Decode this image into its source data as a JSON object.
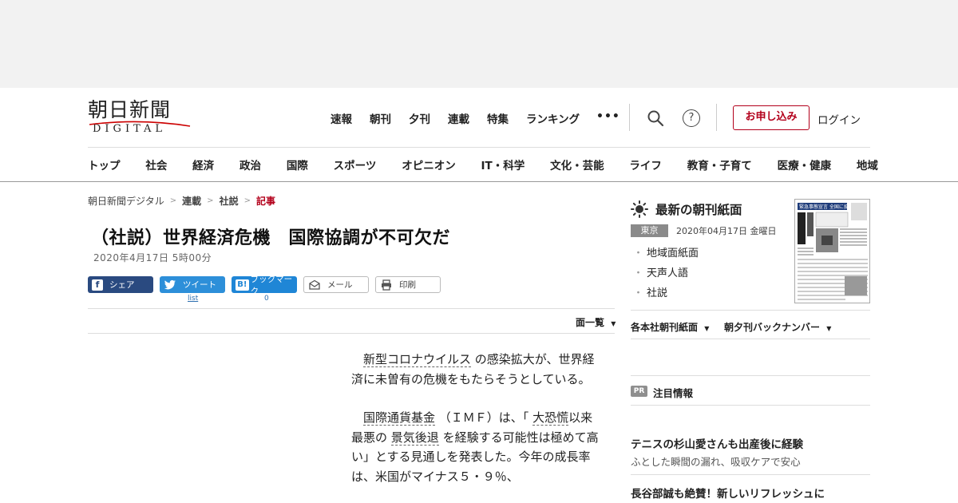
{
  "header": {
    "logo_main": "朝日新聞",
    "logo_sub": "DIGITAL",
    "top_nav": [
      "速報",
      "朝刊",
      "夕刊",
      "連載",
      "特集",
      "ランキング"
    ],
    "more": "•••",
    "help": "?",
    "subscribe": "お申し込み",
    "login": "ログイン"
  },
  "categories": [
    "トップ",
    "社会",
    "経済",
    "政治",
    "国際",
    "スポーツ",
    "オピニオン",
    "IT・科学",
    "文化・芸能",
    "ライフ",
    "教育・子育て",
    "医療・健康",
    "地域"
  ],
  "breadcrumb": [
    "朝日新聞デジタル",
    "連載",
    "社説",
    "記事"
  ],
  "article": {
    "title": "（社説）世界経済危機　国際協調が不可欠だ",
    "date": "2020年4月17日 5時00分",
    "share": {
      "facebook": "シェア",
      "twitter": "ツイート",
      "hatena_icon": "B!",
      "hatena": "ブックマーク",
      "mail": "メール",
      "print": "印刷",
      "twitter_count": "list",
      "hatena_count": "0"
    },
    "index_link": "面一覧",
    "p1_kw": "新型コロナウイルス",
    "p1_rest": "の感染拡大が、世界経済に未曽有の危機をもたらそうとしている。",
    "p2_kw1": "国際通貨基金",
    "p2_a": "（ＩＭＦ）は、「",
    "p2_kw2": "大恐慌",
    "p2_b": "以来最悪の",
    "p2_kw3": "景気後退",
    "p2_c": "を経験する可能性は極めて高い」とする見通しを発表した。今年の成長率は、米国がマイナス５・９％、"
  },
  "sidebar": {
    "chokan_title": "最新の朝刊紙面",
    "area": "東京",
    "date": "2020年04月17日 金曜日",
    "links": [
      "地域面紙面",
      "天声人語",
      "社説"
    ],
    "thumb_headline": "緊急事態宣言 全国に拡大",
    "dropdown1": "各本社朝刊紙面",
    "dropdown2": "朝夕刊バックナンバー",
    "pr_badge": "PR",
    "chumoku": "注目情報",
    "pr1_title": "テニスの杉山愛さんも出産後に経験",
    "pr1_sub": "ふとした瞬間の漏れ、吸収ケアで安心",
    "pr2_title": "長谷部誠も絶賛！新しいリフレッシュに"
  },
  "colors": {
    "accent_red": "#b3001b",
    "facebook": "#2a4a80",
    "twitter": "#2d8fd9",
    "hatena": "#1f86d6"
  }
}
